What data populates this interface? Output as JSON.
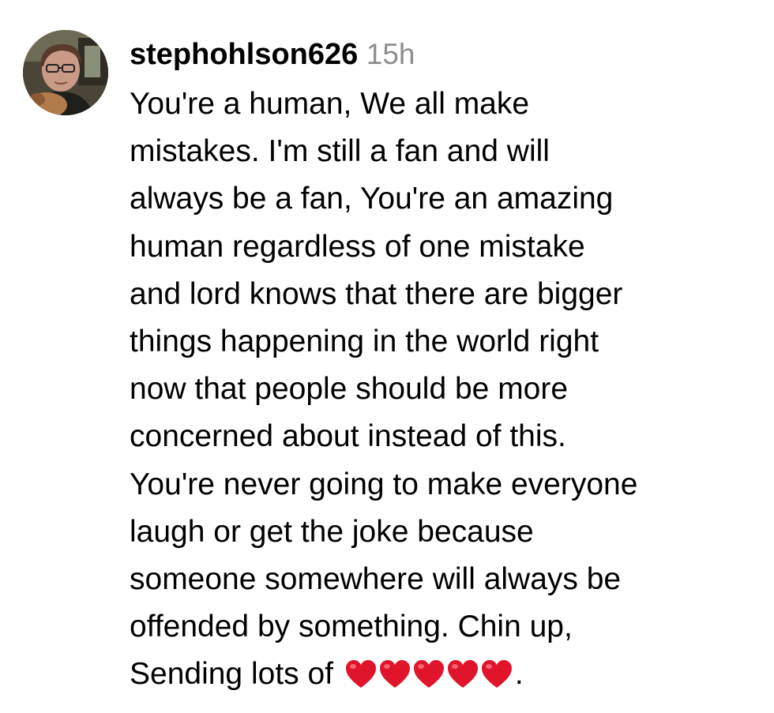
{
  "comment": {
    "avatar_icon": "profile-photo",
    "username": "stephohlson626",
    "timestamp": "15h",
    "lines": [
      "You're a human, We all make",
      "mistakes. I'm still a fan and will",
      "always be a fan, You're an amazing",
      "human regardless of one mistake",
      "and lord knows that there are bigger",
      "things happening in the world right",
      "now that people should be more",
      "concerned about instead of this.",
      "You're never going to make everyone",
      "laugh or get the joke because",
      "someone somewhere will always be",
      "offended by something. Chin up,"
    ],
    "last_line_prefix": "Sending lots of ",
    "heart_count": 5,
    "heart_icon": "red-heart-emoji",
    "heart_color": "#e0142a",
    "last_line_suffix": "."
  }
}
